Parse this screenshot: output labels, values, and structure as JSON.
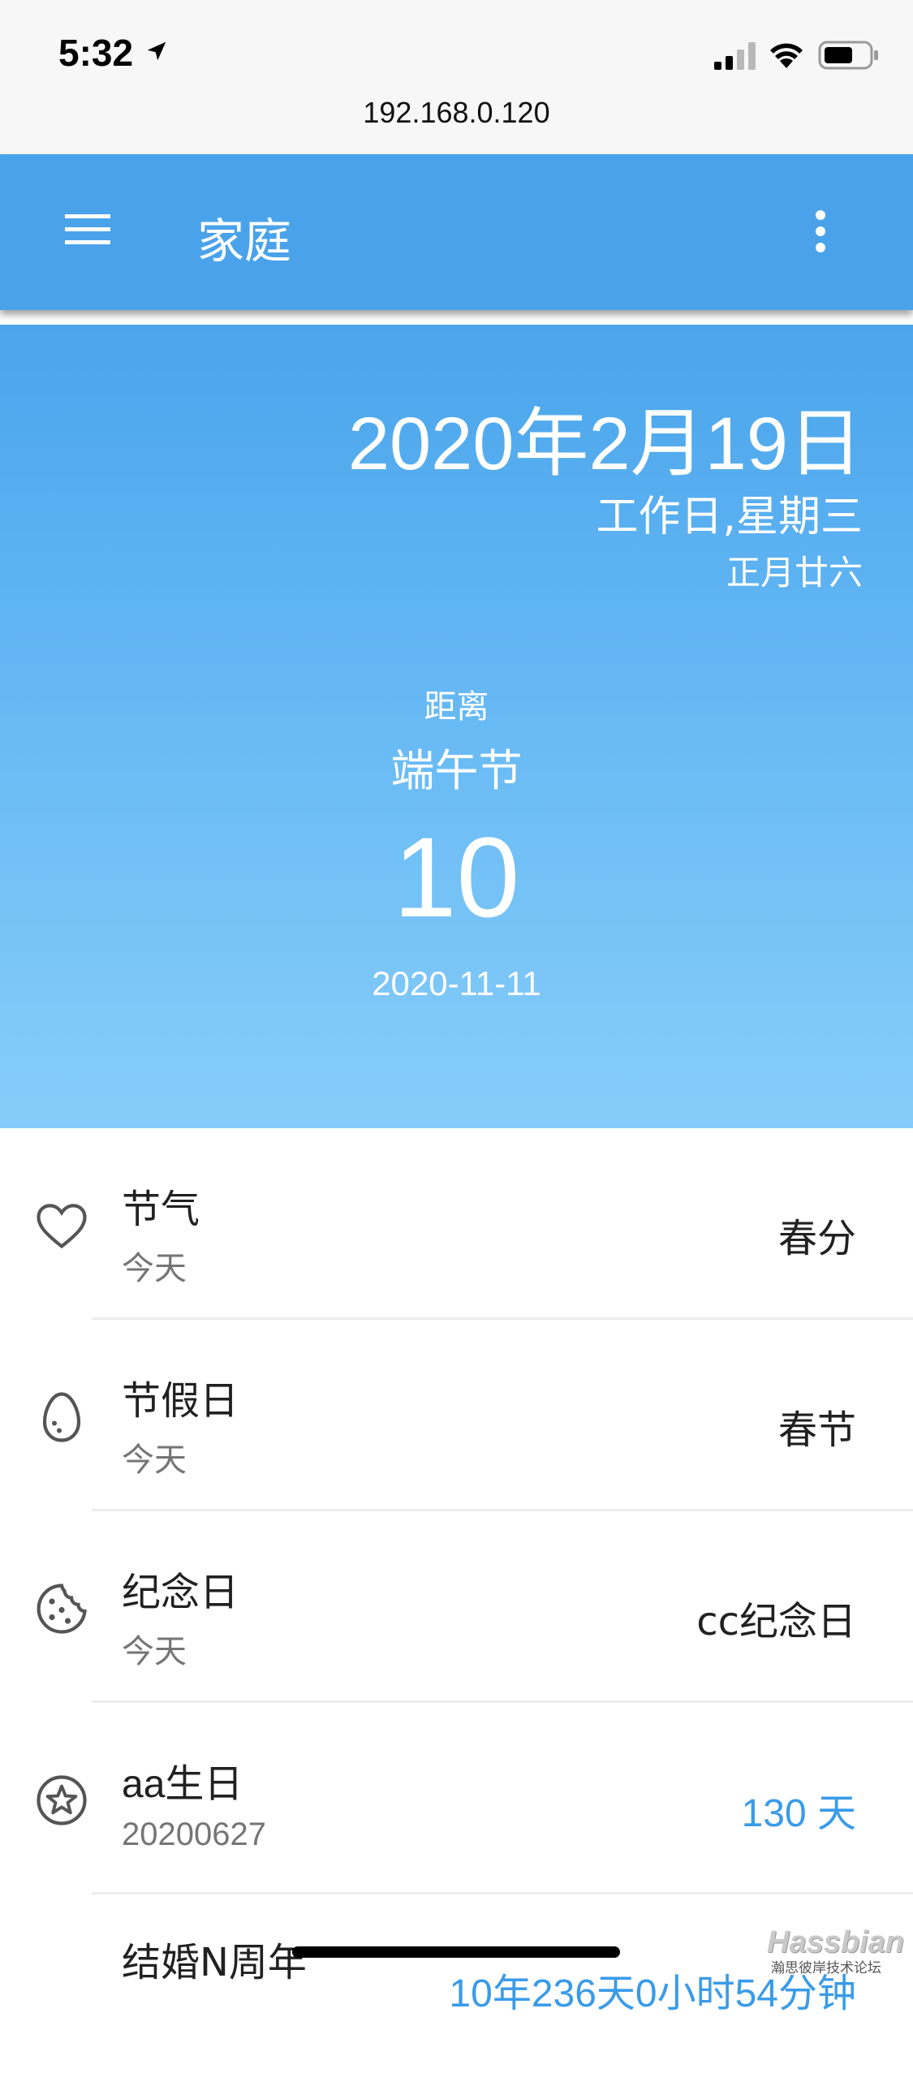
{
  "status_bar": {
    "time": "5:32",
    "url": "192.168.0.120"
  },
  "toolbar": {
    "title": "家庭",
    "menu_icon": "hamburger-menu-icon",
    "more_icon": "more-vert-icon",
    "background_color": "#4aa3ea"
  },
  "hero": {
    "date": "2020年2月19日",
    "weekday": "工作日,星期三",
    "lunar": "正月廿六",
    "distance_label": "距离",
    "festival": "端午节",
    "days": "10",
    "target_date": "2020-11-11"
  },
  "list": {
    "items": [
      {
        "icon": "heart-outline-icon",
        "title": "节气",
        "subtitle": "今天",
        "value": "春分"
      },
      {
        "icon": "egg-outline-icon",
        "title": "节假日",
        "subtitle": "今天",
        "value": "春节"
      },
      {
        "icon": "cookie-outline-icon",
        "title": "纪念日",
        "subtitle": "今天",
        "value": "cc纪念日"
      },
      {
        "icon": "star-circle-outline-icon",
        "title": "aa生日",
        "subtitle": "20200627",
        "value": "130 天",
        "value_color": "#3a9be8"
      },
      {
        "icon": "",
        "title": "结婚N周年",
        "subtitle": "",
        "value": "10年236天0小时54分钟",
        "value_color": "#3a9be8"
      }
    ]
  },
  "watermark": {
    "brand": "Hassbian",
    "caption": "瀚思彼岸技术论坛"
  }
}
